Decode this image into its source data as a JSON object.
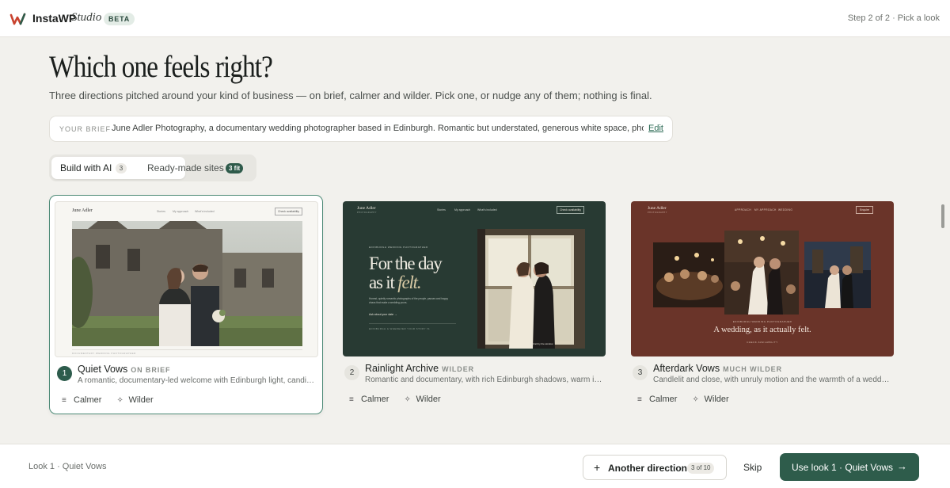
{
  "header": {
    "brand": "InstaWP",
    "brand_studio": "Studio",
    "beta": "BETA",
    "step": "Step 2 of 2 · Pick a look"
  },
  "hero": {
    "title": "Which one feels right?",
    "subtitle": "Three directions pitched around your kind of business — on brief, calmer and wilder. Pick one, or nudge any of them; nothing is final."
  },
  "brief": {
    "label": "YOUR BRIEF",
    "text": "June Adler Photography, a documentary wedding photographer based in Edinburgh. Romantic but understated, generous white space, phot…",
    "edit": "Edit"
  },
  "tabs": [
    {
      "label": "Build with AI",
      "count": "3"
    },
    {
      "label": "Ready-made sites",
      "count": "3 fit"
    }
  ],
  "cards": [
    {
      "number": "1",
      "name": "Quiet Vows",
      "tag": "ON BRIEF",
      "description": "A romantic, documentary-led welcome with Edinburgh light, candi…",
      "calmer": "Calmer",
      "wilder": "Wilder",
      "preview": {
        "logo": "June Adler",
        "nav": [
          "Stories",
          "My approach",
          "What's included"
        ],
        "cta": "Check availability",
        "caption": "DOCUMENTARY WEDDING PHOTOGRAPHER",
        "bg": "#f7f6f2"
      }
    },
    {
      "number": "2",
      "name": "Rainlight Archive",
      "tag": "WILDER",
      "description": "Romantic and documentary, with rich Edinburgh shadows, warm iv…",
      "calmer": "Calmer",
      "wilder": "Wilder",
      "preview": {
        "logo": "June Adler",
        "sublogo": "PHOTOGRAPHY",
        "nav": [
          "Stories",
          "My approach",
          "What's included"
        ],
        "cta": "Check availability",
        "kicker": "EDINBURGH WEDDING PHOTOGRAPHER",
        "headline_1": "For the day",
        "headline_2a": "as it",
        "headline_2b": "felt.",
        "body": "Honest, quietly romantic photographs of the people, pauses and happy chaos that make a wedding yours.",
        "link": "Ask about your date →",
        "footer": "EDINBURGH & WHEREVER YOUR STORY IS",
        "photo_caption": "Portrait by the window",
        "bg": "#283a33"
      }
    },
    {
      "number": "3",
      "name": "Afterdark Vows",
      "tag": "MUCH WILDER",
      "description": "Candlelit and close, with unruly motion and the warmth of a weddi…",
      "calmer": "Calmer",
      "wilder": "Wilder",
      "preview": {
        "logo": "June Adler",
        "sublogo": "PHOTOGRAPHY",
        "nav": [
          "APPROACH",
          "MY APPROACH",
          "WEDDING"
        ],
        "cta": "Enquire",
        "kicker": "EDINBURGH WEDDING PHOTOGRAPHER",
        "headline": "A wedding, as it actually felt.",
        "link": "CHECK AVAILABILITY",
        "bg": "#6a3429"
      }
    }
  ],
  "footer": {
    "left": "Look 1 · Quiet Vows",
    "another": "Another direction",
    "another_count": "3 of 10",
    "skip": "Skip",
    "use": "Use look 1 · Quiet Vows"
  },
  "icons": {
    "logo": "instawp-logo-icon",
    "plus": "plus-icon",
    "arrow": "arrow-right-icon",
    "calmer": "sliders-icon",
    "wilder": "sparkle-icon"
  },
  "colors": {
    "accent": "#2e5c4b",
    "page_bg": "#f2f1ed",
    "card2_bg": "#283a33",
    "card3_bg": "#6a3429"
  }
}
